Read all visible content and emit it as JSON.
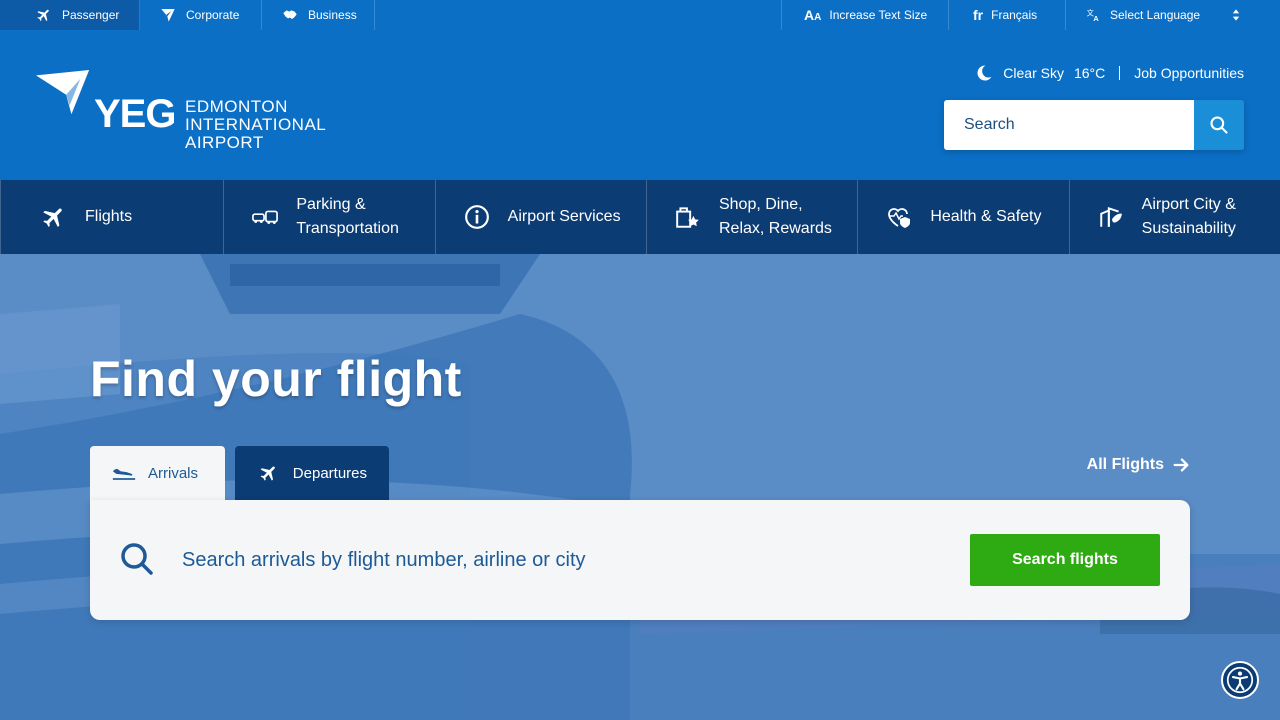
{
  "topbar": {
    "audience_tabs": [
      {
        "label": "Passenger",
        "icon": "plane-icon",
        "active": true
      },
      {
        "label": "Corporate",
        "icon": "paper-plane-icon",
        "active": false
      },
      {
        "label": "Business",
        "icon": "handshake-icon",
        "active": false
      }
    ],
    "increase_text": "Increase Text Size",
    "francais": "Français",
    "select_language": "Select Language"
  },
  "header": {
    "logo_mark": "YEG",
    "logo_name_1": "EDMONTON",
    "logo_name_2": "INTERNATIONAL",
    "logo_name_3": "AIRPORT",
    "weather_text": "Clear Sky",
    "temperature": "16°C",
    "job_link": "Job Opportunities",
    "search_placeholder": "Search"
  },
  "mainnav": [
    {
      "label": "Flights",
      "icon": "plane-icon"
    },
    {
      "label": "Parking &\nTransportation",
      "icon": "car-bus-icon"
    },
    {
      "label": "Airport Services",
      "icon": "info-icon"
    },
    {
      "label": "Shop, Dine,\nRelax, Rewards",
      "icon": "shopping-bag-star-icon"
    },
    {
      "label": "Health & Safety",
      "icon": "heart-shield-icon"
    },
    {
      "label": "Airport City &\nSustainability",
      "icon": "leaf-building-icon"
    }
  ],
  "hero": {
    "title": "Find your flight",
    "tab_arrivals": "Arrivals",
    "tab_departures": "Departures",
    "all_flights": "All Flights",
    "flight_search_placeholder": "Search arrivals by flight number, airline or city",
    "search_button": "Search flights"
  },
  "colors": {
    "topbar": "#0b6fc6",
    "nav": "#0c3c74",
    "search_button": "#2eaa12",
    "search_icon_bg": "#1a8fd8"
  }
}
